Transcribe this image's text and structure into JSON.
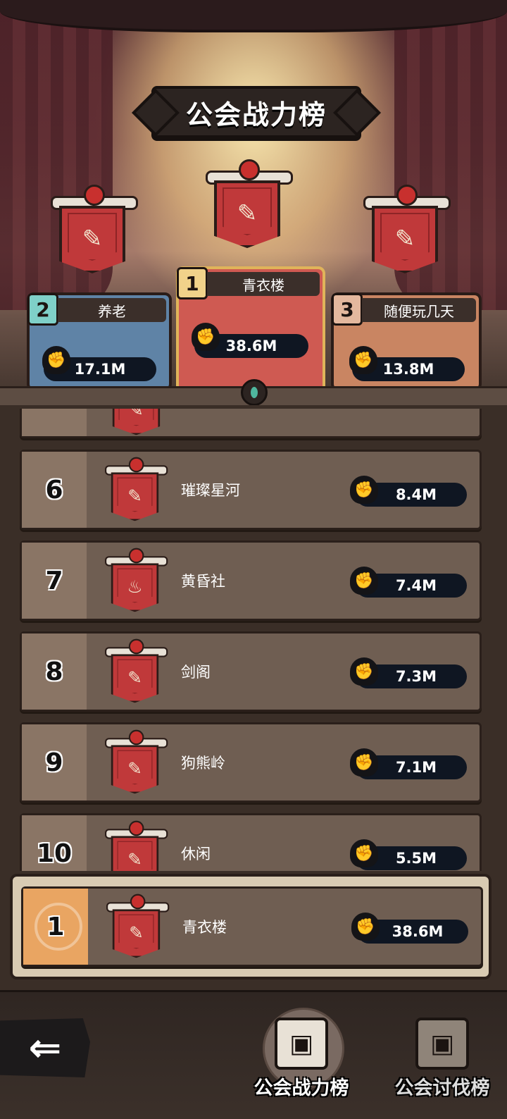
{
  "title": "公会战力榜",
  "podium": [
    {
      "rank": "2",
      "name": "养老",
      "power": "17.1M",
      "emblem": "brush"
    },
    {
      "rank": "1",
      "name": "青衣楼",
      "power": "38.6M",
      "emblem": "brush"
    },
    {
      "rank": "3",
      "name": "随便玩几天",
      "power": "13.8M",
      "emblem": "brush"
    }
  ],
  "rows": [
    {
      "rank": "",
      "name": "",
      "power": "",
      "emblem": "brush"
    },
    {
      "rank": "6",
      "name": "璀璨星河",
      "power": "8.4M",
      "emblem": "brush"
    },
    {
      "rank": "7",
      "name": "黄昏社",
      "power": "7.4M",
      "emblem": "flame"
    },
    {
      "rank": "8",
      "name": "剑阁",
      "power": "7.3M",
      "emblem": "brush"
    },
    {
      "rank": "9",
      "name": "狗熊岭",
      "power": "7.1M",
      "emblem": "brush"
    },
    {
      "rank": "10",
      "name": "休闲",
      "power": "5.5M",
      "emblem": "brush"
    }
  ],
  "self": {
    "rank": "1",
    "name": "青衣楼",
    "power": "38.6M",
    "emblem": "brush"
  },
  "icons": {
    "emblem_brush": "✎",
    "emblem_flame": "♨",
    "fist": "✊",
    "back": "⇐",
    "tab": "▣"
  },
  "nav": {
    "back_label": "",
    "tabs": [
      {
        "label": "公会战力榜",
        "active": true
      },
      {
        "label": "公会讨伐榜",
        "active": false
      }
    ]
  },
  "colors": {
    "rank1": "#cf5a52",
    "rank2": "#5f83a6",
    "rank3": "#c98562",
    "self_rank": "#e9a562"
  }
}
